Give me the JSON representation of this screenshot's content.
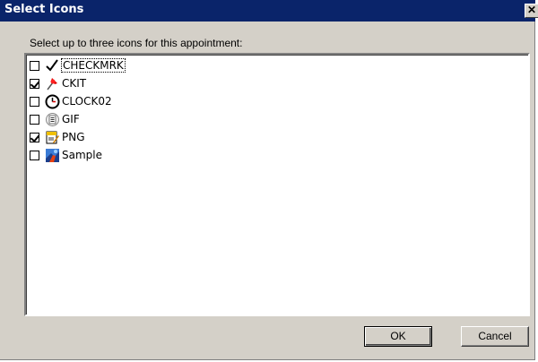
{
  "window": {
    "title": "Select Icons",
    "close_glyph": "✕"
  },
  "prompt": "Select up to three icons for this appointment:",
  "items": [
    {
      "label": "CHECKMRK",
      "checked": false,
      "icon": "checkmark-icon",
      "focused": true
    },
    {
      "label": "CKIT",
      "checked": true,
      "icon": "pushpin-icon",
      "focused": false
    },
    {
      "label": "CLOCK02",
      "checked": false,
      "icon": "clock-icon",
      "focused": false
    },
    {
      "label": "GIF",
      "checked": false,
      "icon": "gif-file-icon",
      "focused": false
    },
    {
      "label": "PNG",
      "checked": true,
      "icon": "png-file-icon",
      "focused": false
    },
    {
      "label": "Sample",
      "checked": false,
      "icon": "sample-image-icon",
      "focused": false
    }
  ],
  "buttons": {
    "ok": "OK",
    "cancel": "Cancel"
  },
  "colors": {
    "titlebar": "#0a246a",
    "face": "#d4d0c8"
  }
}
